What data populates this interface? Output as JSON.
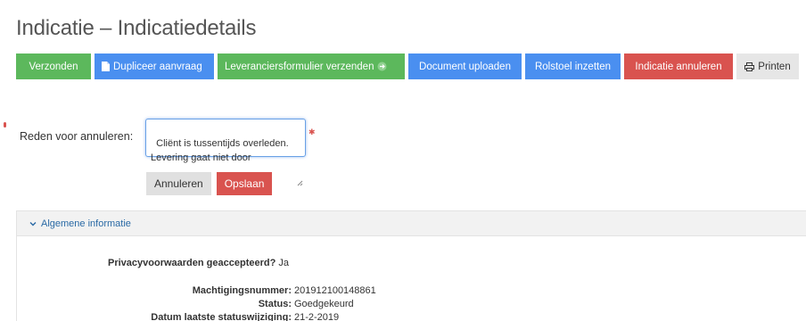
{
  "page": {
    "title": "Indicatie – Indicatiedetails"
  },
  "toolbar": {
    "buttons": [
      {
        "label": "Verzonden",
        "color": "#5cb85c"
      },
      {
        "label": "Dupliceer aanvraag",
        "color": "#4a8ff0",
        "icon": "file-icon"
      },
      {
        "label": "Leveranciersformulier verzenden",
        "color": "#5cb85c",
        "icon": "send-icon"
      },
      {
        "label": "Document uploaden",
        "color": "#4a8ff0"
      },
      {
        "label": "Rolstoel inzetten",
        "color": "#4a8ff0"
      },
      {
        "label": "Indicatie annuleren",
        "color": "#d9534f"
      },
      {
        "label": "Printen",
        "color": "#e6e6e6",
        "icon": "printer-icon"
      }
    ]
  },
  "cancel_form": {
    "label": "Reden voor annuleren:",
    "value": "Cliënt is tussentijds overleden.\nLevering gaat niet door",
    "cancel_label": "Annuleren",
    "save_label": "Opslaan"
  },
  "general_info": {
    "header": "Algemene informatie",
    "privacy_label": "Privacyvoorwaarden geaccepteerd?",
    "privacy_value": "Ja",
    "auth_label": "Machtigingsnummer:",
    "auth_value": "201912100148861",
    "status_label": "Status:",
    "status_value": "Goedgekeurd",
    "date_label": "Datum laatste statuswijziging:",
    "date_value": "21-2-2019"
  }
}
